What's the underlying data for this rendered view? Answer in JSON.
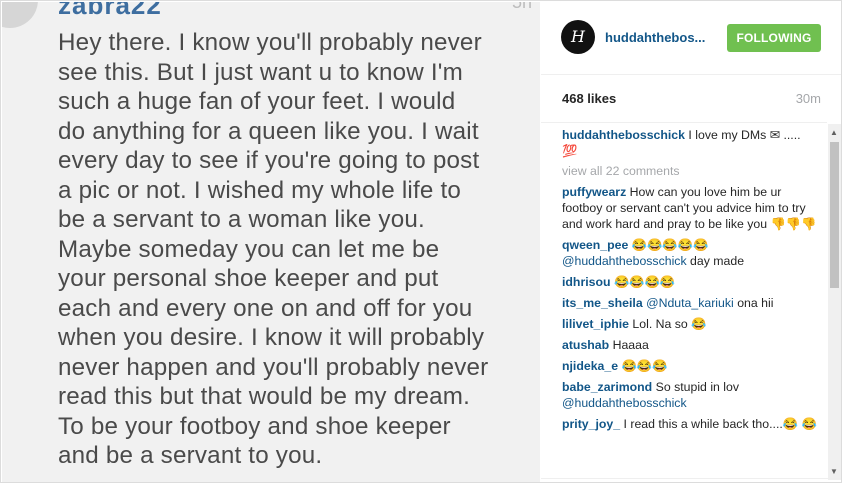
{
  "photo": {
    "username_partial": "zabra22",
    "stamp": "5h",
    "message_lines": [
      "Hey there. I know you'll probably never",
      "see this. But I just want u to know I'm",
      "such a huge fan of your feet. I would",
      "do anything for a queen like you. I wait",
      "every day to see if you're going to post",
      "a pic or not. I wished my whole life to",
      "be a servant to a woman like you.",
      "Maybe someday you can let me be",
      "your personal shoe keeper and put",
      "each and every one on and off for you",
      "when you desire. I know it will probably",
      "never happen and you'll probably never",
      "read this but that would be my dream.",
      "To be your footboy and shoe keeper",
      "and be a servant to you."
    ]
  },
  "header": {
    "logo_glyph": "H",
    "username": "huddahthebos...",
    "follow_label": "FOLLOWING"
  },
  "stats": {
    "likes": "468 likes",
    "time_ago": "30m"
  },
  "caption": {
    "user": "huddahthebosschick",
    "text": "I love my DMs ✉ ..... 💯"
  },
  "view_all": "view all 22 comments",
  "comments": [
    {
      "user": "puffywearz",
      "text": "How can you love him be ur footboy or servant can't you advice him to try and work hard and pray to be like you 👎👎👎"
    },
    {
      "user": "qween_pee",
      "text": "😂😂😂😂😂",
      "mention": "@huddahthebosschick",
      "after": "day made"
    },
    {
      "user": "idhrisou",
      "text": "😂😂😂😂"
    },
    {
      "user": "its_me_sheila",
      "text": "",
      "mention": "@Nduta_kariuki",
      "after": "ona hii"
    },
    {
      "user": "lilivet_iphie",
      "text": "Lol. Na so 😂"
    },
    {
      "user": "atushab",
      "text": "Haaaa"
    },
    {
      "user": "njideka_e",
      "text": "😂😂😂"
    },
    {
      "user": "babe_zarimond",
      "text": "So stupid in lov",
      "mention": "@huddahthebosschick",
      "after": ""
    },
    {
      "user": "prity_joy_",
      "text": "I read this a while back tho....😂 😂"
    }
  ],
  "scrollbar": {
    "up": "▲",
    "down": "▼"
  }
}
